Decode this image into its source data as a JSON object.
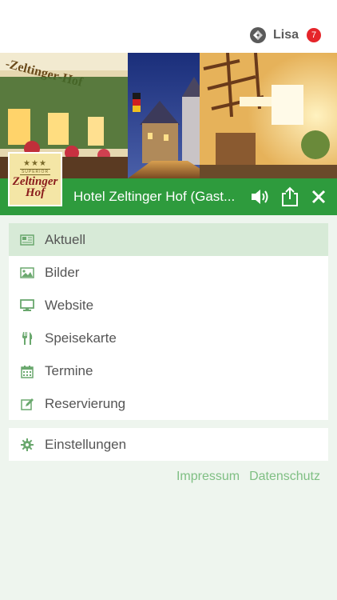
{
  "header": {
    "user_name": "Lisa",
    "notification_count": "7",
    "user_icon": "swirl-logo-icon"
  },
  "hero": {
    "image_description_icon": "hotel-street-photo",
    "sign_text": "-Zeltinger-Hof"
  },
  "logo": {
    "stars": "★★★",
    "superior": "SUPERIOR",
    "name_line1": "Zeltinger",
    "name_line2": "Hof"
  },
  "titlebar": {
    "title": "Hotel Zeltinger Hof (Gast...",
    "icons": [
      "speaker-icon",
      "share-icon",
      "close-icon"
    ]
  },
  "menu": {
    "items": [
      {
        "label": "Aktuell",
        "icon": "newspaper-icon",
        "active": true
      },
      {
        "label": "Bilder",
        "icon": "image-icon",
        "active": false
      },
      {
        "label": "Website",
        "icon": "monitor-icon",
        "active": false
      },
      {
        "label": "Speisekarte",
        "icon": "cutlery-icon",
        "active": false
      },
      {
        "label": "Termine",
        "icon": "calendar-icon",
        "active": false
      },
      {
        "label": "Reservierung",
        "icon": "edit-icon",
        "active": false
      }
    ],
    "settings": {
      "label": "Einstellungen",
      "icon": "gear-icon"
    }
  },
  "footer": {
    "impressum": "Impressum",
    "datenschutz": "Datenschutz"
  },
  "colors": {
    "accent": "#2e9b3d",
    "active_bg": "#d7ead7",
    "badge": "#e5252a",
    "link": "#7fbf83"
  }
}
